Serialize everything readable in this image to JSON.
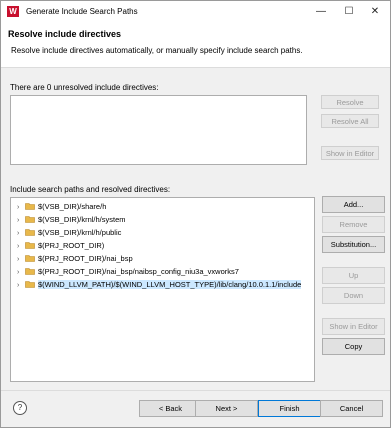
{
  "window": {
    "title": "Generate Include Search Paths",
    "app_icon_letter": "W",
    "controls": {
      "minimize": "—",
      "maximize": "☐",
      "close": "✕"
    }
  },
  "header": {
    "title": "Resolve include directives",
    "description": "Resolve include directives automatically, or manually specify include search paths."
  },
  "unresolved": {
    "label": "There are 0 unresolved include directives:",
    "buttons": {
      "resolve": "Resolve",
      "resolve_all": "Resolve All",
      "show_in_editor": "Show in Editor"
    }
  },
  "paths": {
    "label": "Include search paths and resolved directives:",
    "items": [
      {
        "text": "$(VSB_DIR)/share/h"
      },
      {
        "text": "$(VSB_DIR)/krnl/h/system"
      },
      {
        "text": "$(VSB_DIR)/krnl/h/public"
      },
      {
        "text": "$(PRJ_ROOT_DIR)"
      },
      {
        "text": "$(PRJ_ROOT_DIR)/nai_bsp"
      },
      {
        "text": "$(PRJ_ROOT_DIR)/nai_bsp/naibsp_config_niu3a_vxworks7"
      },
      {
        "text": "$(WIND_LLVM_PATH)/$(WIND_LLVM_HOST_TYPE)/lib/clang/10.0.1.1/include"
      }
    ],
    "buttons": {
      "add": "Add...",
      "remove": "Remove",
      "substitution": "Substitution...",
      "up": "Up",
      "down": "Down",
      "show_in_editor": "Show in Editor",
      "copy": "Copy"
    }
  },
  "footer": {
    "help": "?",
    "back": "< Back",
    "next": "Next >",
    "finish": "Finish",
    "cancel": "Cancel"
  },
  "colors": {
    "folder": "#e8b84a",
    "accent": "#0078d7",
    "brand": "#c8102e"
  }
}
